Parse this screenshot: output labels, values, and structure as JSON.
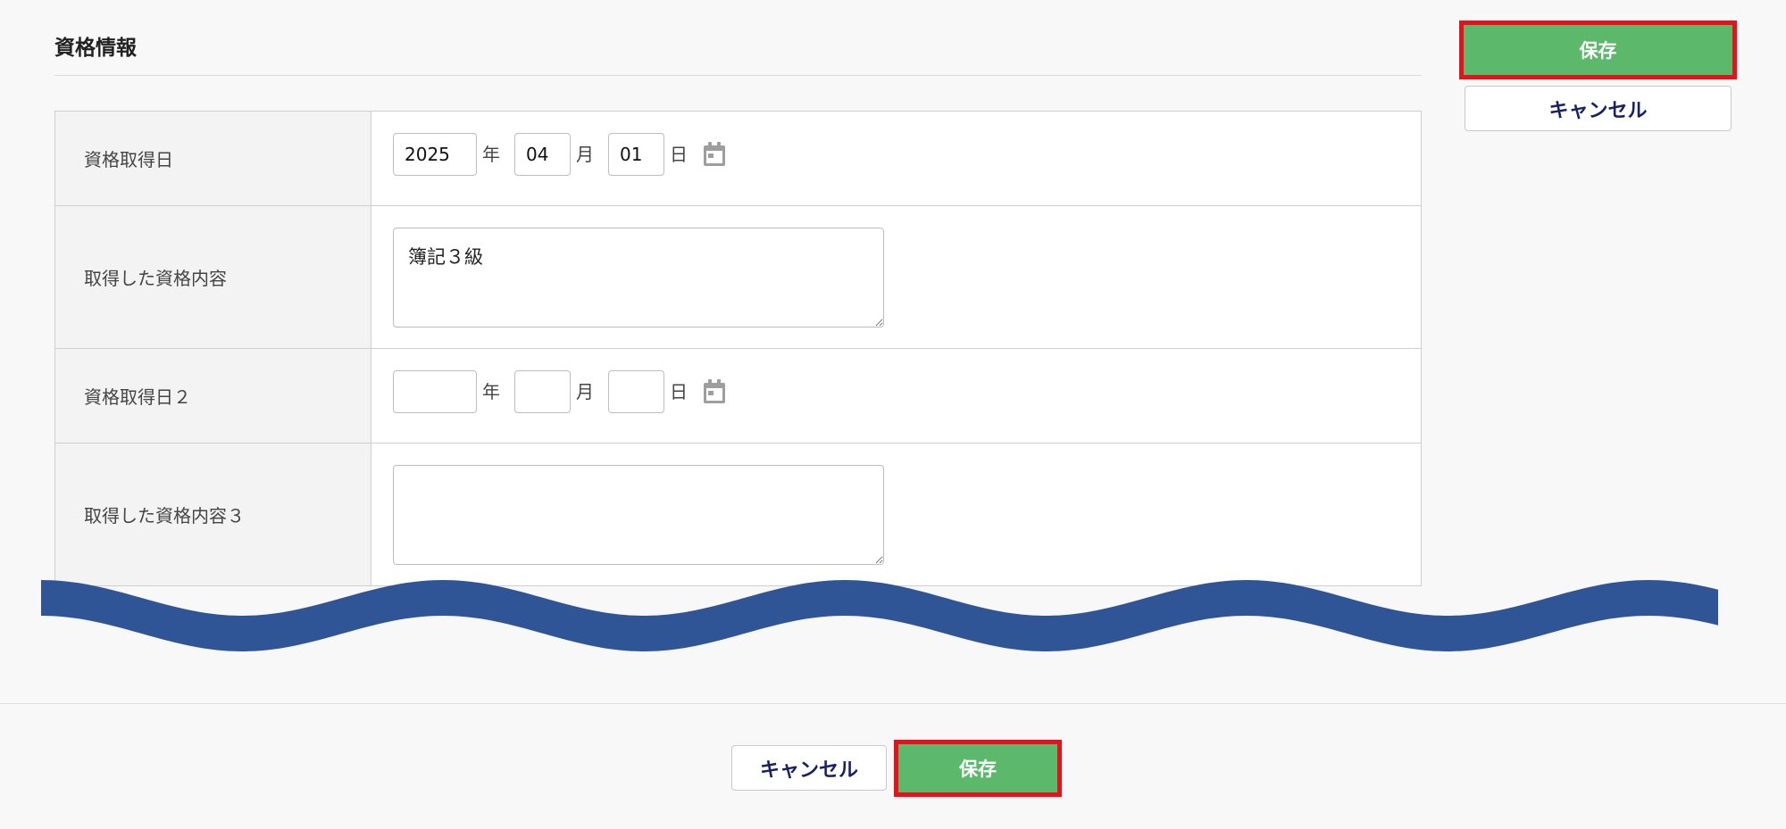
{
  "section": {
    "title": "資格情報"
  },
  "actions": {
    "save_label": "保存",
    "cancel_label": "キャンセル"
  },
  "form": {
    "rows": [
      {
        "label": "資格取得日",
        "type": "date",
        "year": "2025",
        "month": "04",
        "day": "01"
      },
      {
        "label": "取得した資格内容",
        "type": "textarea",
        "value": "簿記３級"
      },
      {
        "label": "資格取得日２",
        "type": "date",
        "year": "",
        "month": "",
        "day": ""
      },
      {
        "label": "取得した資格内容３",
        "type": "textarea",
        "value": ""
      }
    ],
    "units": {
      "year": "年",
      "month": "月",
      "day": "日"
    }
  },
  "icons": {
    "calendar": "calendar-icon",
    "wave": "wave-divider"
  },
  "colors": {
    "save_bg": "#5cb86a",
    "highlight_border": "#e8101a",
    "cancel_text": "#1a2266",
    "wave": "#2f5597"
  }
}
